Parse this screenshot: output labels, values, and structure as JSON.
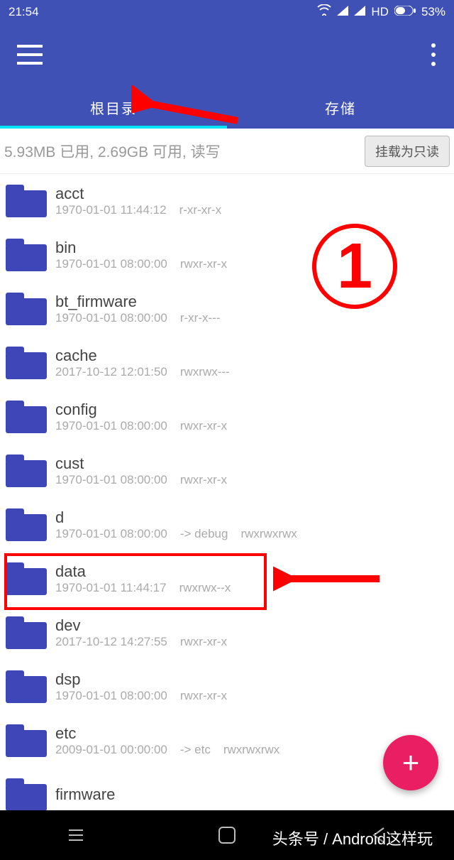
{
  "statusbar": {
    "time": "21:54",
    "hd": "HD",
    "battery": "53%"
  },
  "tabs": {
    "root": "根目录",
    "storage": "存储"
  },
  "infobar": {
    "text": "5.93MB 已用, 2.69GB 可用, 读写",
    "mount_btn": "挂载为只读"
  },
  "list": [
    {
      "name": "acct",
      "date": "1970-01-01 11:44:12",
      "perm": "r-xr-xr-x",
      "link": ""
    },
    {
      "name": "bin",
      "date": "1970-01-01 08:00:00",
      "perm": "rwxr-xr-x",
      "link": ""
    },
    {
      "name": "bt_firmware",
      "date": "1970-01-01 08:00:00",
      "perm": "r-xr-x---",
      "link": ""
    },
    {
      "name": "cache",
      "date": "2017-10-12 12:01:50",
      "perm": "rwxrwx---",
      "link": ""
    },
    {
      "name": "config",
      "date": "1970-01-01 08:00:00",
      "perm": "rwxr-xr-x",
      "link": ""
    },
    {
      "name": "cust",
      "date": "1970-01-01 08:00:00",
      "perm": "rwxr-xr-x",
      "link": ""
    },
    {
      "name": "d",
      "date": "1970-01-01 08:00:00",
      "perm": "rwxrwxrwx",
      "link": "-> debug"
    },
    {
      "name": "data",
      "date": "1970-01-01 11:44:17",
      "perm": "rwxrwx--x",
      "link": ""
    },
    {
      "name": "dev",
      "date": "2017-10-12 14:27:55",
      "perm": "rwxr-xr-x",
      "link": ""
    },
    {
      "name": "dsp",
      "date": "1970-01-01 08:00:00",
      "perm": "rwxr-xr-x",
      "link": ""
    },
    {
      "name": "etc",
      "date": "2009-01-01 00:00:00",
      "perm": "rwxrwxrwx",
      "link": "-> etc"
    },
    {
      "name": "firmware",
      "date": "",
      "perm": "",
      "link": ""
    }
  ],
  "fab": {
    "label": "+"
  },
  "annotation": {
    "number": "1"
  },
  "watermark": "头条号 / Android这样玩"
}
